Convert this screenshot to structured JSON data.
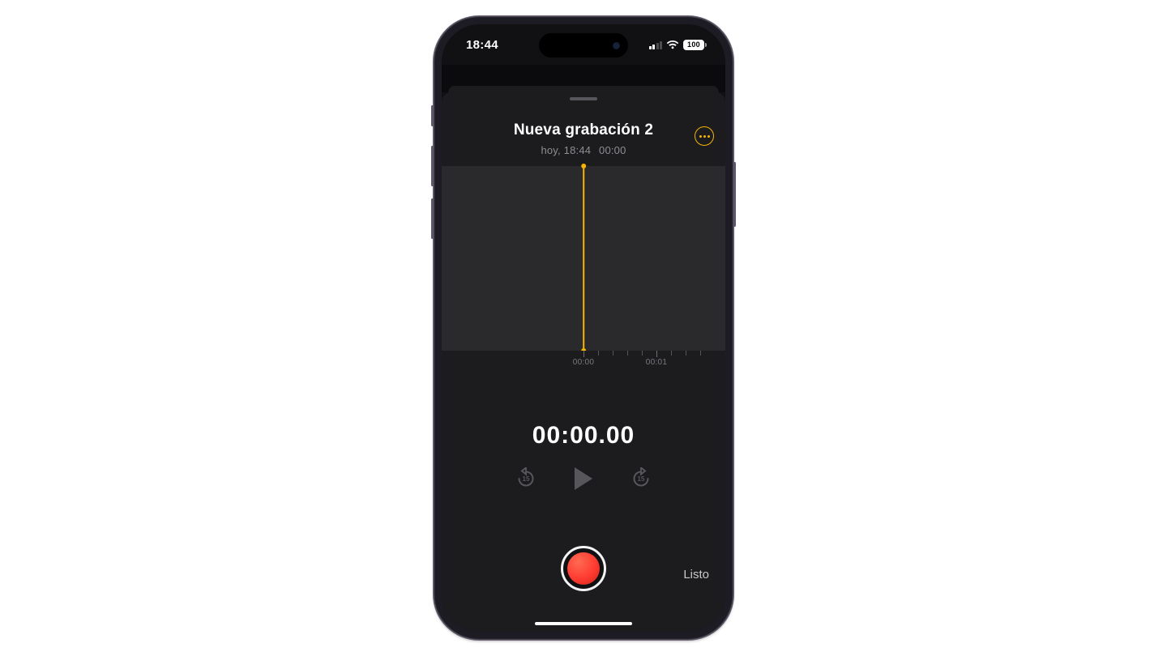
{
  "status": {
    "time": "18:44",
    "battery": "100"
  },
  "recording": {
    "title": "Nueva grabación 2",
    "subtitle_time": "hoy, 18:44",
    "subtitle_duration": "00:00"
  },
  "ruler": {
    "t0": "00:00",
    "t1": "00:01"
  },
  "timer": "00:00.00",
  "transport": {
    "skip_seconds": "15"
  },
  "actions": {
    "done_label": "Listo"
  },
  "colors": {
    "accent": "#f7b500",
    "record": "#ff3b30"
  }
}
